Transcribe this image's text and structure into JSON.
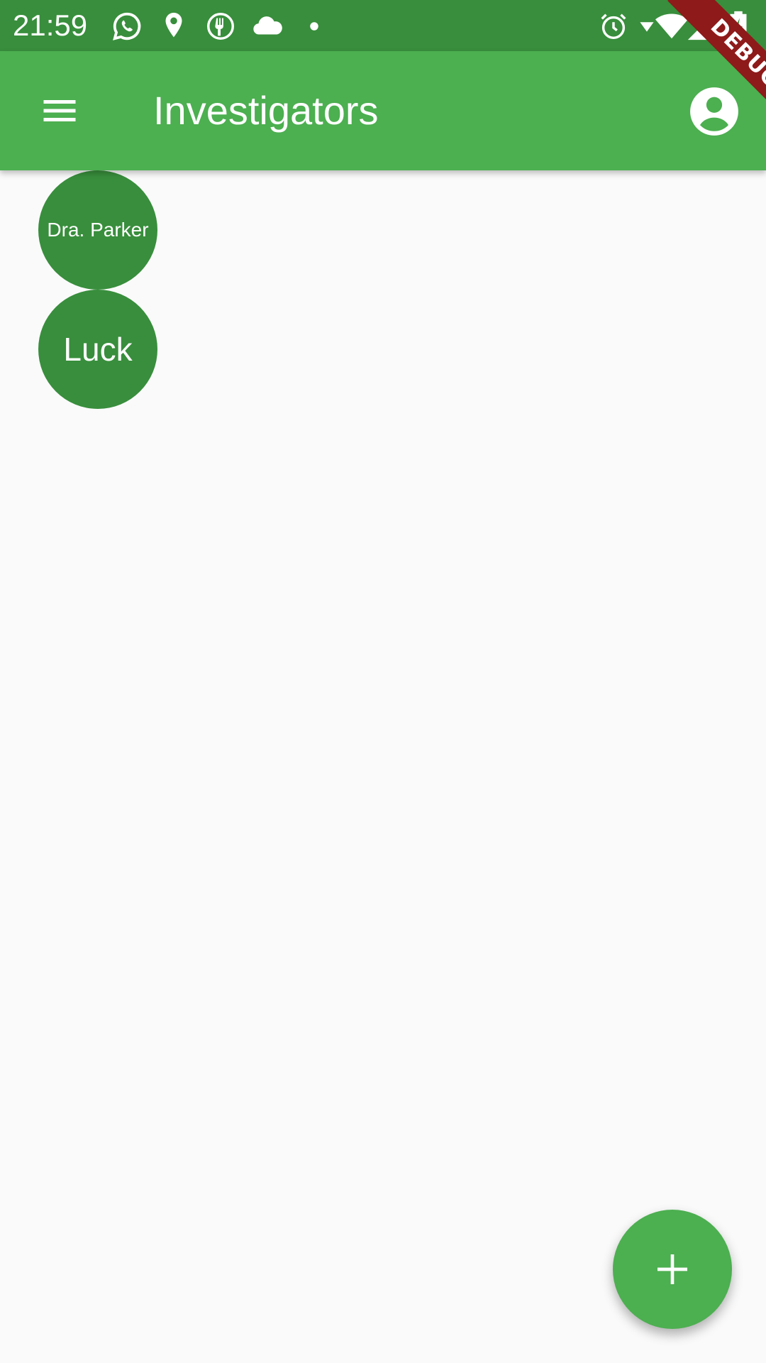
{
  "status_bar": {
    "time": "21:59",
    "left_icons": [
      "whatsapp-icon",
      "location-pin-icon",
      "food-app-icon",
      "cloud-icon",
      "dot-icon"
    ],
    "right_icons": [
      "alarm-icon",
      "wifi-icon",
      "signal-icon",
      "battery-charging-icon"
    ],
    "background_color": "#388e3c"
  },
  "app_bar": {
    "title": "Investigators",
    "menu_icon": "menu-icon",
    "account_icon": "account-circle-icon",
    "background_color": "#4caf50"
  },
  "debug_banner": {
    "label": "DEBUG",
    "color": "#8e1a1a"
  },
  "investigators": [
    {
      "name": "Dra. Parker"
    },
    {
      "name": "Luck"
    }
  ],
  "avatar_color": "#388e3c",
  "fab": {
    "icon": "add-icon",
    "color": "#4caf50"
  }
}
